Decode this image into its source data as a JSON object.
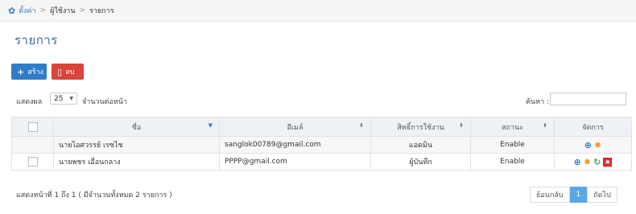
{
  "breadcrumb": {
    "root": "ตั้งค่า",
    "middle": "ผู้ใช้งาน",
    "current": "รายการ",
    "separator": ">"
  },
  "page": {
    "title": "รายการ"
  },
  "toolbar": {
    "create_label": "สร้าง",
    "delete_label": "ลบ"
  },
  "filter": {
    "show_label": "แสดงผล",
    "page_length": "25",
    "per_page_label": "จำนวนต่อหน้า",
    "search_label": "ค้นหา :"
  },
  "table": {
    "columns": [
      "ชื่อ",
      "อีเมล์",
      "สิทธิ์การใช้งาน",
      "สถานะ",
      "จัดการ"
    ],
    "rows": [
      {
        "name": "นายไอศวรรย์ เรซไช",
        "email": "sanglok00789@gmail.com",
        "role": "แอดมิน",
        "status": "Enable"
      },
      {
        "name": "นายพชร เอื่อนกลาง",
        "email": "PPPP@gmail.com",
        "role": "ผู้บันทึก",
        "status": "Enable"
      }
    ]
  },
  "info_text": "แสดงหน้าที่ 1 ถึง 1 ( มีจำนวนทั้งหมด 2 รายการ )",
  "pagination": {
    "prev": "ย้อนกลับ",
    "current": "1",
    "next": "ถัดไป"
  },
  "colors": {
    "primary": "#2f7cc7",
    "danger": "#d9443b",
    "title": "#3e6d9c",
    "header_bg": "#eef1f5"
  },
  "icons": {
    "breadcrumb": "gear-icon",
    "create": "plus-icon",
    "delete": "trash-icon",
    "actions": [
      "zoom-icon",
      "settings-icon",
      "refresh-icon",
      "trash-icon"
    ]
  }
}
